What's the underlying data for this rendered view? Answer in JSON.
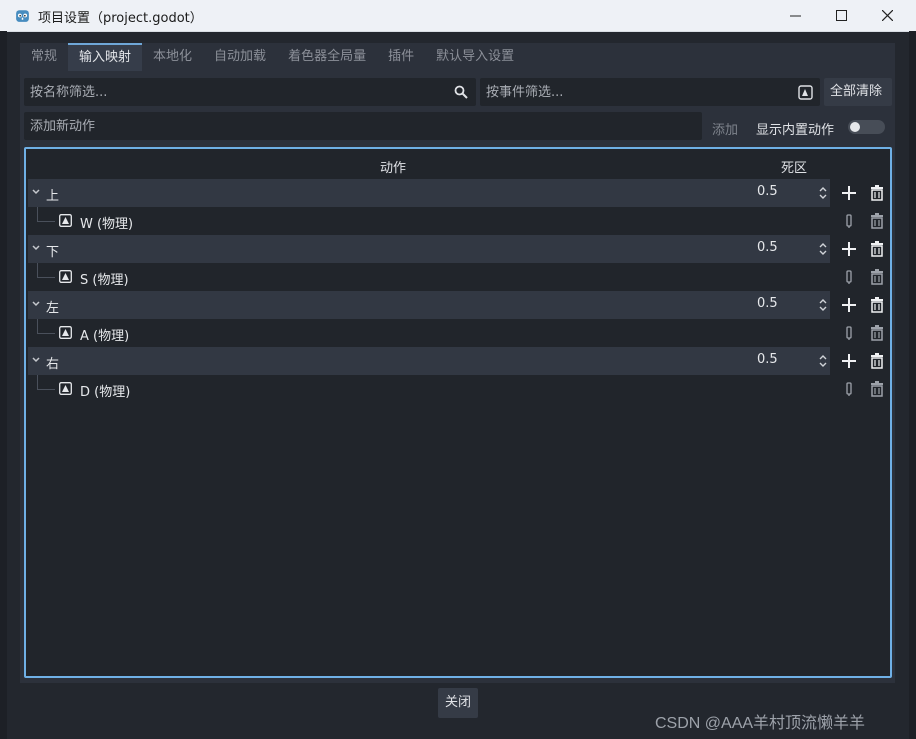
{
  "window": {
    "title": "项目设置（project.godot）",
    "minimize": "—",
    "maximize": "☐",
    "close": "✕"
  },
  "tabs": [
    {
      "label": "常规",
      "active": false
    },
    {
      "label": "输入映射",
      "active": true
    },
    {
      "label": "本地化",
      "active": false
    },
    {
      "label": "自动加载",
      "active": false
    },
    {
      "label": "着色器全局量",
      "active": false
    },
    {
      "label": "插件",
      "active": false
    },
    {
      "label": "默认导入设置",
      "active": false
    }
  ],
  "filters": {
    "name_placeholder": "按名称筛选...",
    "event_placeholder": "按事件筛选...",
    "clear_all": "全部清除"
  },
  "add_action": {
    "placeholder": "添加新动作",
    "add_label": "添加",
    "show_builtin_label": "显示内置动作",
    "show_builtin_on": false
  },
  "table": {
    "col_action": "动作",
    "col_deadzone": "死区",
    "actions": [
      {
        "name": "上",
        "deadzone": "0.5",
        "event": "W (物理)"
      },
      {
        "name": "下",
        "deadzone": "0.5",
        "event": "S (物理)"
      },
      {
        "name": "左",
        "deadzone": "0.5",
        "event": "A (物理)"
      },
      {
        "name": "右",
        "deadzone": "0.5",
        "event": "D (物理)"
      }
    ]
  },
  "footer": {
    "close_label": "关闭"
  },
  "watermark": "CSDN @AAA羊村顶流懒羊羊",
  "colors": {
    "accent": "#6fb0e6",
    "background": "#23272e",
    "panel": "#2c313b"
  }
}
